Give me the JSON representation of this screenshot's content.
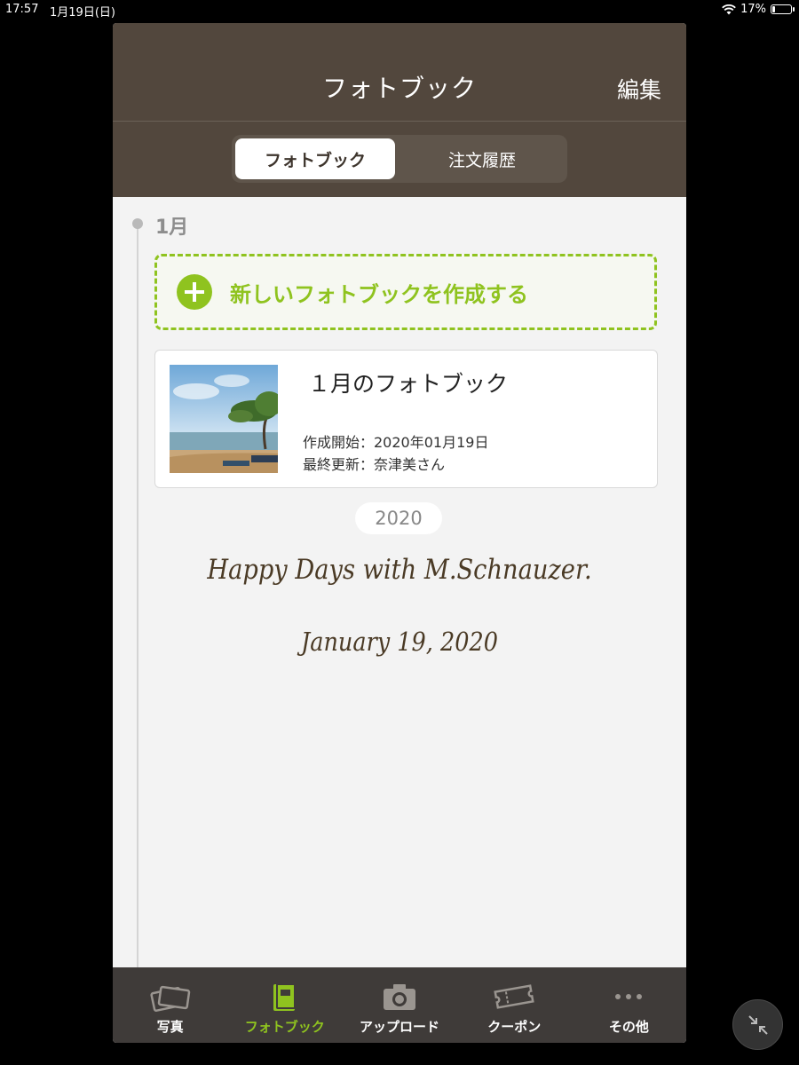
{
  "status_bar": {
    "time": "17:57",
    "date": "1月19日(日)",
    "battery": "17%",
    "battery_level": 0.17
  },
  "navbar": {
    "title": "フォトブック",
    "edit_label": "編集"
  },
  "segments": {
    "active": "フォトブック",
    "inactive": "注文履歴"
  },
  "timeline": {
    "month": "1月",
    "new_book_label": "新しいフォトブックを作成する",
    "book": {
      "title": "１月のフォトブック",
      "created": "作成開始：2020年01月19日",
      "updated": "最終更新：奈津美さん"
    },
    "year": "2020"
  },
  "cover": {
    "title": "Happy Days with M.Schnauzer.",
    "date": "January 19, 2020"
  },
  "tabs": [
    {
      "label": "写真",
      "icon": "photos-icon"
    },
    {
      "label": "フォトブック",
      "icon": "photobook-icon"
    },
    {
      "label": "アップロード",
      "icon": "camera-icon"
    },
    {
      "label": "クーポン",
      "icon": "coupon-icon"
    },
    {
      "label": "その他",
      "icon": "more-icon"
    }
  ],
  "colors": {
    "nav_brown": "#52473d",
    "accent_green": "#8fc31f",
    "tabbar": "#3f3b39"
  }
}
